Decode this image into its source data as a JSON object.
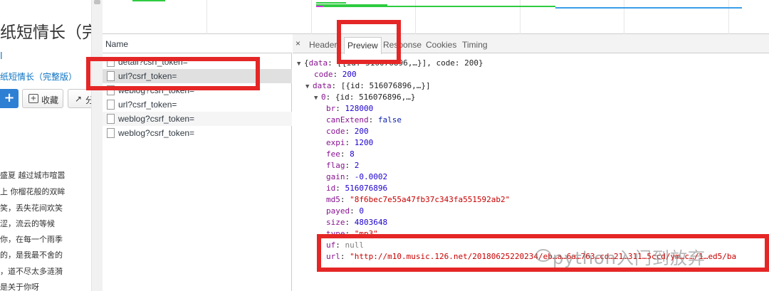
{
  "left_page": {
    "song_title": "纸短情长（完",
    "artist_fragment": "l",
    "album_link": "纸短情长（完整版）",
    "add_label": "+",
    "favorite_label": "收藏",
    "share_label": "分",
    "lyrics": [
      "盛夏 越过城市喧嚣",
      "上 你榴花般的双眸",
      "笑，丢失花间欢笑",
      "涩，流云的等候",
      "你，在每一个雨季",
      "的，是我最不舍的",
      "，道不尽太多涟漪",
      "是关于你呀"
    ]
  },
  "devtools": {
    "list_header": "Name",
    "requests": [
      {
        "name": "detail?csrf_token="
      },
      {
        "name": "url?csrf_token="
      },
      {
        "name": "weblog?csrf_token="
      },
      {
        "name": "url?csrf_token="
      },
      {
        "name": "weblog?csrf_token="
      },
      {
        "name": "weblog?csrf_token="
      }
    ],
    "selected_index": 1,
    "tabs": [
      "Headers",
      "Preview",
      "Response",
      "Cookies",
      "Timing"
    ],
    "active_tab": "Preview",
    "close_label": "×",
    "preview": {
      "root_key": "data",
      "root_summary": ": [{id: 516076896,…}], code: 200}",
      "code": {
        "key": "code",
        "value": "200"
      },
      "data": {
        "key": "data",
        "summary": "[{id: 516076896,…}]"
      },
      "item": {
        "key": "0",
        "summary": "{id: 516076896,…}"
      },
      "fields": [
        {
          "key": "br",
          "value": "128000",
          "kind": "num"
        },
        {
          "key": "canExtend",
          "value": "false",
          "kind": "kw"
        },
        {
          "key": "code",
          "value": "200",
          "kind": "num"
        },
        {
          "key": "expi",
          "value": "1200",
          "kind": "num"
        },
        {
          "key": "fee",
          "value": "8",
          "kind": "num"
        },
        {
          "key": "flag",
          "value": "2",
          "kind": "num"
        },
        {
          "key": "gain",
          "value": "-0.0002",
          "kind": "num"
        },
        {
          "key": "id",
          "value": "516076896",
          "kind": "num"
        },
        {
          "key": "md5",
          "value": "\"8f6bec7e55a47fb37c343fa551592ab2\"",
          "kind": "str"
        },
        {
          "key": "payed",
          "value": "0",
          "kind": "num"
        },
        {
          "key": "size",
          "value": "4803648",
          "kind": "num"
        },
        {
          "key": "type",
          "value": "\"mp3\"",
          "kind": "str"
        },
        {
          "key": "uf",
          "value": "null",
          "kind": "nul"
        },
        {
          "key": "url",
          "value": "\"http://m10.music.126.net/20180625220234/eb…a…6a…763…cd…21…311…5ccd/ym…c…/1…ed5/ba",
          "kind": "str"
        }
      ]
    }
  },
  "watermark": "python入门到放弃",
  "colors": {
    "annotation_red": "#e52626",
    "json_key": "#881391",
    "json_number": "#1c00cf",
    "json_string": "#c80000",
    "link_blue": "#0c73c2"
  }
}
